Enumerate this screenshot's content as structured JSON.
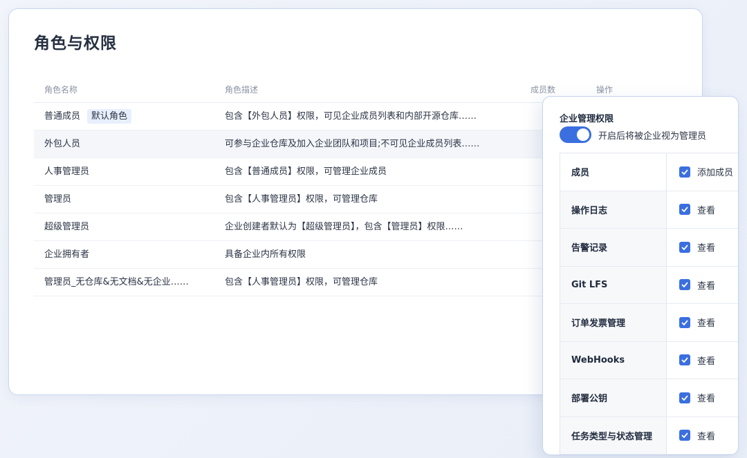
{
  "page": {
    "title": "角色与权限"
  },
  "roles_table": {
    "columns": {
      "name": "角色名称",
      "desc": "角色描述",
      "members": "成员数",
      "actions": "操作"
    },
    "rows": [
      {
        "name": "普通成员",
        "badge": "默认角色",
        "desc": "包含【外包人员】权限，可见企业成员列表和内部开源仓库……"
      },
      {
        "name": "外包人员",
        "desc": "可参与企业仓库及加入企业团队和项目;不可见企业成员列表……"
      },
      {
        "name": "人事管理员",
        "desc": "包含【普通成员】权限，可管理企业成员"
      },
      {
        "name": "管理员",
        "desc": "包含【人事管理员】权限，可管理仓库"
      },
      {
        "name": "超级管理员",
        "desc": "企业创建者默认为【超级管理员】，包含【管理员】权限……"
      },
      {
        "name": "企业拥有者",
        "desc": "具备企业内所有权限"
      },
      {
        "name": "管理员_无仓库&无文档&无企业……",
        "desc": "包含【人事管理员】权限，可管理仓库"
      }
    ]
  },
  "permissions_panel": {
    "title": "企业管理权限",
    "toggle": {
      "on": true,
      "label": "开启后将被企业视为管理员"
    },
    "accent_color": "#3b6fe0",
    "items": [
      {
        "category": "成员",
        "permission": "添加成员",
        "checked": true
      },
      {
        "category": "操作日志",
        "permission": "查看",
        "checked": true
      },
      {
        "category": "告警记录",
        "permission": "查看",
        "checked": true
      },
      {
        "category": "Git LFS",
        "permission": "查看",
        "checked": true
      },
      {
        "category": "订单发票管理",
        "permission": "查看",
        "checked": true
      },
      {
        "category": "WebHooks",
        "permission": "查看",
        "checked": true
      },
      {
        "category": "部署公钥",
        "permission": "查看",
        "checked": true
      },
      {
        "category": "任务类型与状态管理",
        "permission": "查看",
        "checked": true
      }
    ]
  }
}
